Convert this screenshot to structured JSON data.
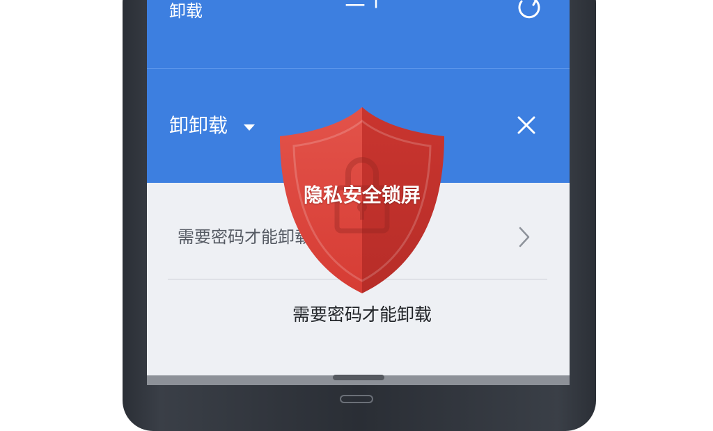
{
  "topbar": {
    "title": "卸载",
    "center_label": "二十"
  },
  "appbar": {
    "title": "卸卸载"
  },
  "content": {
    "row_label": "需要密码才能卸载",
    "center_text": "需要密码才能卸载"
  },
  "overlay": {
    "shield_text": "隐私安全锁屏"
  },
  "icons": {
    "refresh": "refresh-icon",
    "dropdown": "dropdown-icon",
    "close": "close-icon",
    "chevron": "chevron-right-icon",
    "shield": "shield-icon",
    "lock": "lock-icon"
  },
  "colors": {
    "accent": "#3d7fe0",
    "shield_red": "#d9403a",
    "background": "#eef0f4"
  }
}
